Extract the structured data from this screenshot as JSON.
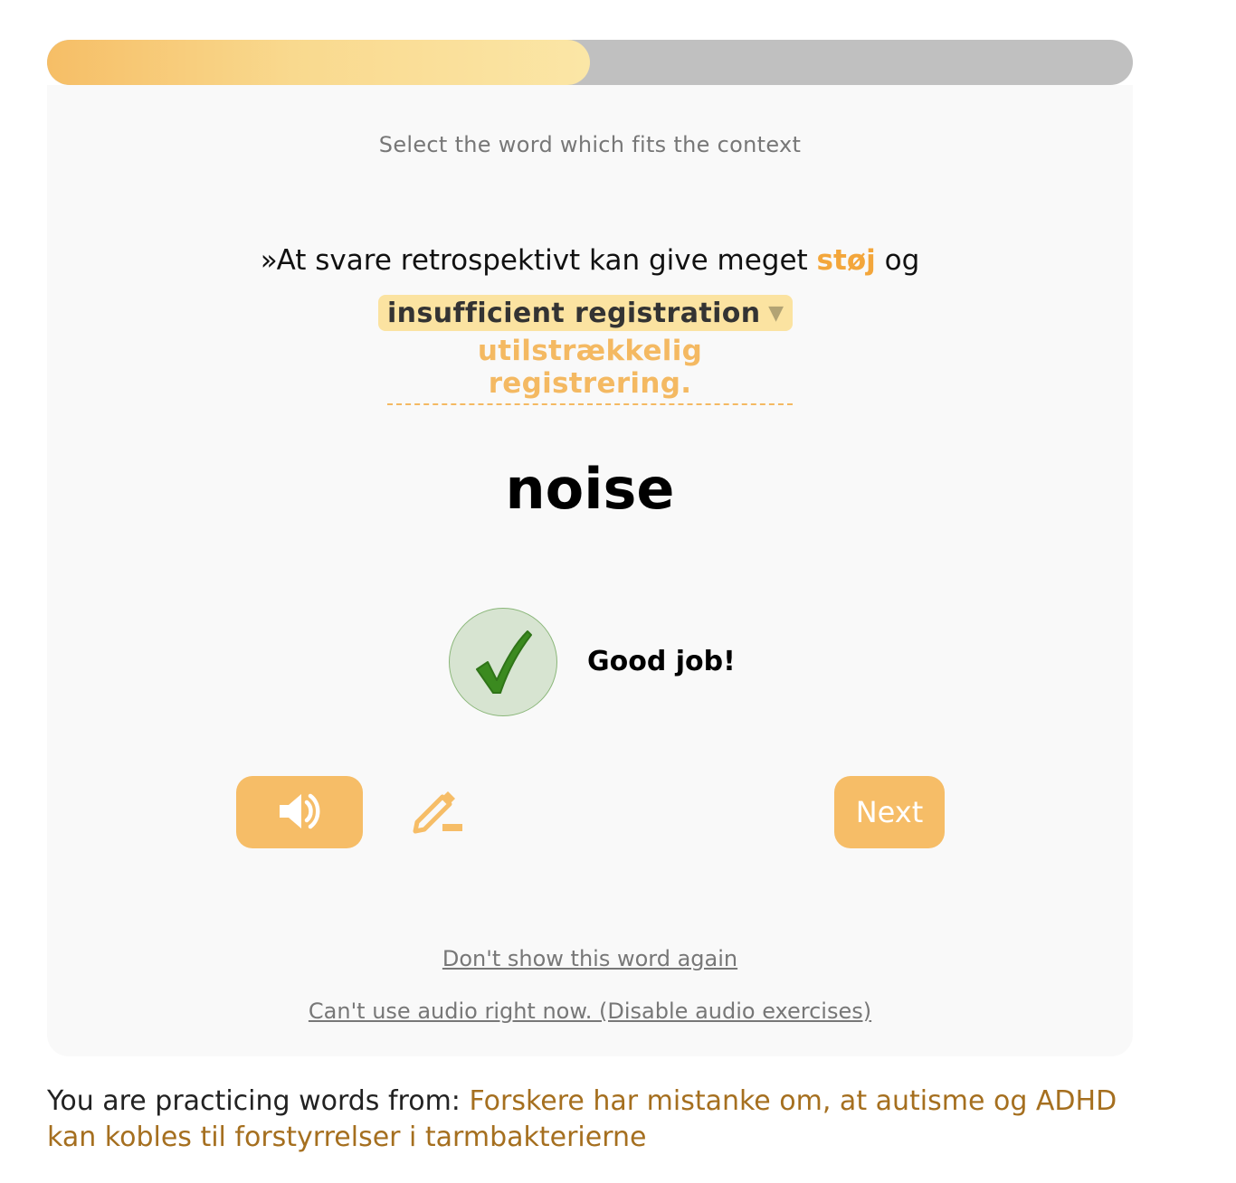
{
  "progress": {
    "fraction": 0.5
  },
  "exercise": {
    "instruction": "Select the word which fits the context",
    "sentence_prefix": "»At svare retrospektivt kan give meget ",
    "highlight_word": "støj",
    "sentence_suffix": " og",
    "translation_hint": "insufficient registration",
    "completed_phrase": "utilstrækkelig registrering.",
    "target_word": "noise"
  },
  "feedback": {
    "message": "Good job!",
    "status": "correct"
  },
  "actions": {
    "audio_icon": "speaker-icon",
    "edit_icon": "pencil-icon",
    "next_label": "Next"
  },
  "links": {
    "hide_word": "Don't show this word again",
    "disable_audio": "Can't use audio right now. (Disable audio exercises)"
  },
  "footer": {
    "prefix": "You are practicing words from: ",
    "article_title": "Forskere har mistanke om, at autisme og ADHD kan kobles til forstyrrelser i tarmbakterierne"
  },
  "colors": {
    "accent": "#f6bd67",
    "highlight": "#f3a63b",
    "success_bg": "#d7e4d1",
    "success_check": "#3b8a1f",
    "link_brown": "#a56f1f"
  }
}
